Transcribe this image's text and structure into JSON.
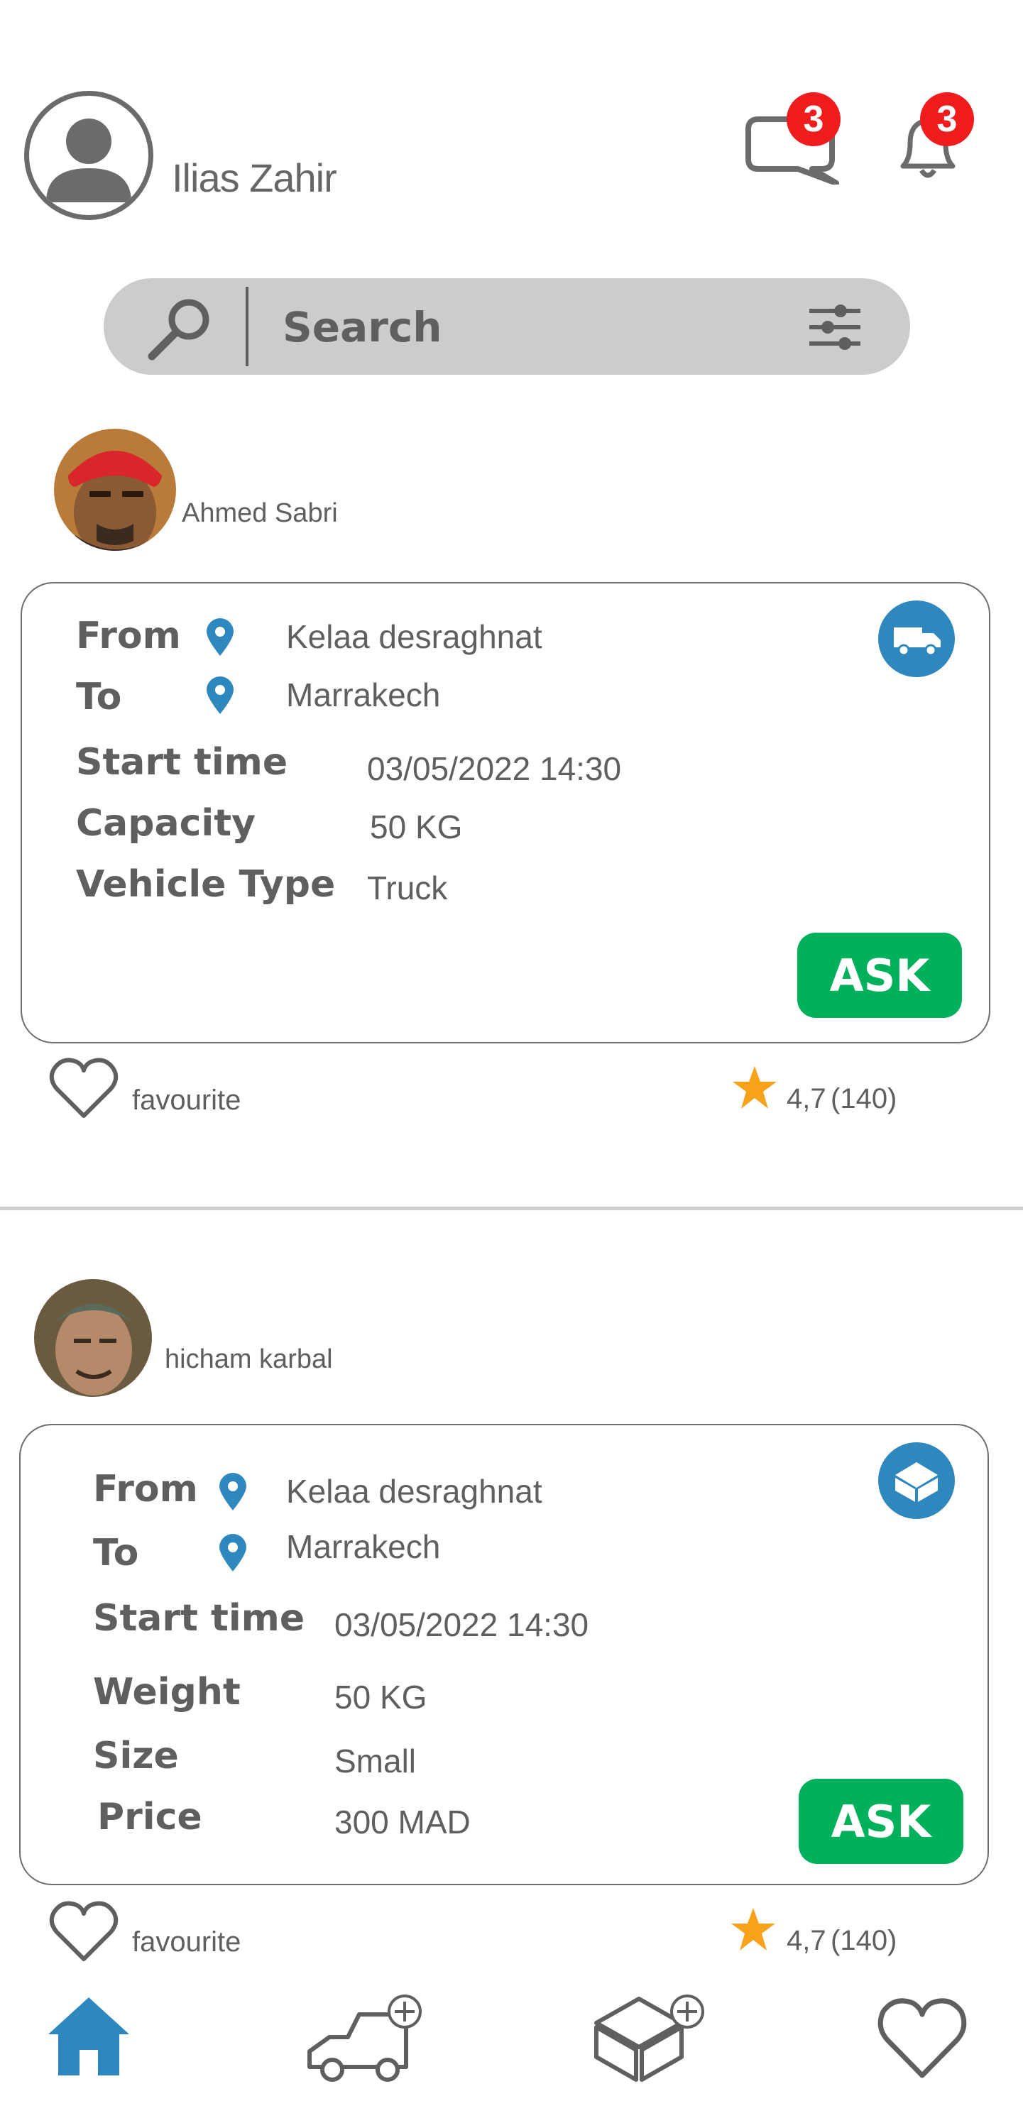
{
  "header": {
    "user_name": "Ilias Zahir",
    "messages_count": "3",
    "notifications_count": "3"
  },
  "search": {
    "placeholder": "Search"
  },
  "posts": [
    {
      "poster_name": "Ahmed Sabri",
      "type_icon": "truck-icon",
      "rows": [
        {
          "label": "From",
          "value": "Kelaa desraghnat"
        },
        {
          "label": "To",
          "value": "Marrakech"
        },
        {
          "label": "Start time",
          "value": "03/05/2022 14:30"
        },
        {
          "label": "Capacity",
          "value": "50 KG"
        },
        {
          "label": "Vehicle Type",
          "value": "Truck"
        }
      ],
      "ask_label": "ASK",
      "favourite_label": "favourite",
      "rating": "4,7",
      "reviews": "(140)"
    },
    {
      "poster_name": "hicham karbal",
      "type_icon": "package-icon",
      "rows": [
        {
          "label": "From",
          "value": "Kelaa desraghnat"
        },
        {
          "label": "To",
          "value": "Marrakech"
        },
        {
          "label": "Start time",
          "value": "03/05/2022 14:30"
        },
        {
          "label": "Weight",
          "value": "50 KG"
        },
        {
          "label": "Size",
          "value": "Small"
        },
        {
          "label": "Price",
          "value": "300 MAD"
        }
      ],
      "ask_label": "ASK",
      "favourite_label": "favourite",
      "rating": "4,7",
      "reviews": "(140)"
    }
  ],
  "bottom_nav": {
    "items": [
      "home-icon",
      "add-trip-icon",
      "add-package-icon",
      "favourites-icon"
    ]
  },
  "colors": {
    "accent_blue": "#2e87bd",
    "ask_green": "#00b05a",
    "badge_red": "#ee1c1c",
    "star": "#f7a21b",
    "text_gray": "#5f5f5f"
  }
}
